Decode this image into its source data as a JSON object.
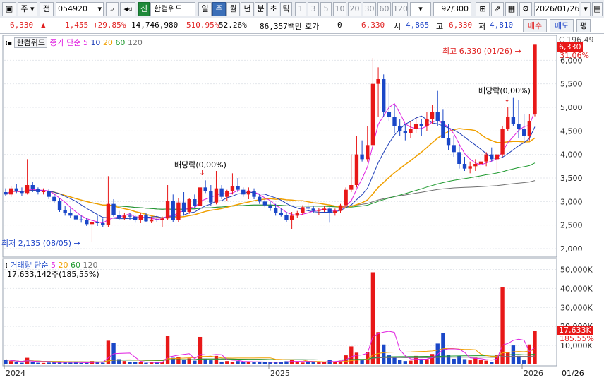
{
  "toolbar": {
    "market": "주",
    "scope": "전",
    "code": "054920",
    "badge": "신",
    "name": "한컴위드",
    "periods": [
      "일",
      "주",
      "월",
      "년",
      "분",
      "초",
      "틱"
    ],
    "minutes": [
      "1",
      "3",
      "5",
      "10",
      "20",
      "30",
      "60",
      "120"
    ],
    "count": "92/300",
    "date": "2026/01/26"
  },
  "info": {
    "price": "6,330",
    "change": "1,455",
    "rate": "+29.85%",
    "volume": "14,746,980",
    "vol_ratio": "510.95%",
    "turnover": "52.26%",
    "amount": "86,357백만",
    "quote_label": "호가",
    "quote_val": "0",
    "quote_price": "6,330",
    "open_label": "시",
    "open": "4,865",
    "high_label": "고",
    "high": "6,330",
    "low_label": "저",
    "low": "4,810",
    "buy": "매수",
    "sell": "매도",
    "eval": "평"
  },
  "price_legend": {
    "name": "한컴위드",
    "prefix": "종가 단순",
    "ma": [
      "5",
      "10",
      "20",
      "60",
      "120"
    ]
  },
  "volume_legend": {
    "prefix": "거래량 단순",
    "ma": [
      "5",
      "20",
      "60",
      "120"
    ],
    "value": "17,633,142주(185,55%)"
  },
  "annotations": {
    "high": "최고 6,330 (01/26)",
    "low": "최저 2,135 (08/05)",
    "div1": "배당락(0,00%)",
    "div2": "배당락(0,00%)"
  },
  "right_axis": {
    "top_label": "C 196.49",
    "price_tag": "6,330",
    "pct_tag": "31.06%",
    "ticks": [
      "6,000",
      "5,500",
      "5,000",
      "4,500",
      "4,000",
      "3,500",
      "3,000",
      "2,500",
      "2,000"
    ],
    "vol_ticks": [
      "50,000K",
      "40,000K",
      "30,000K",
      "20,000K",
      "10,000K"
    ],
    "vol_tag": "17,633K",
    "vol_pct": "185.55%",
    "date_tag": "01/26"
  },
  "x_axis": [
    "2024",
    "2025",
    "2026"
  ],
  "colors": {
    "up": "#e81818",
    "down": "#1a47c8",
    "ma5": "#e020e0",
    "ma10": "#1f3fb8",
    "ma20": "#f0a000",
    "ma60": "#1f9a2f",
    "ma120": "#707070"
  },
  "chart_data": {
    "type": "candlestick",
    "period": "weekly",
    "ylim": [
      1850,
      6500
    ],
    "candles": [
      [
        3200,
        3280,
        3120,
        3150
      ],
      [
        3150,
        3320,
        3100,
        3280
      ],
      [
        3280,
        3380,
        3180,
        3220
      ],
      [
        3220,
        3300,
        3120,
        3180
      ],
      [
        3180,
        3900,
        3150,
        3350
      ],
      [
        3350,
        3420,
        3200,
        3260
      ],
      [
        3260,
        3300,
        3150,
        3200
      ],
      [
        3200,
        3280,
        3150,
        3220
      ],
      [
        3220,
        3260,
        3050,
        3100
      ],
      [
        3100,
        3150,
        2980,
        3020
      ],
      [
        3020,
        3080,
        2780,
        2820
      ],
      [
        2820,
        2900,
        2700,
        2750
      ],
      [
        2750,
        2850,
        2650,
        2700
      ],
      [
        2700,
        2780,
        2580,
        2620
      ],
      [
        2620,
        2700,
        2550,
        2600
      ],
      [
        2600,
        2660,
        2480,
        2520
      ],
      [
        2520,
        2620,
        2135,
        2560
      ],
      [
        2560,
        2700,
        2480,
        2540
      ],
      [
        2540,
        2640,
        2450,
        2500
      ],
      [
        2500,
        3540,
        2450,
        2950
      ],
      [
        2950,
        3050,
        2680,
        2720
      ],
      [
        2720,
        2800,
        2600,
        2650
      ],
      [
        2650,
        2750,
        2600,
        2700
      ],
      [
        2700,
        2760,
        2600,
        2680
      ],
      [
        2680,
        2720,
        2550,
        2600
      ],
      [
        2600,
        2750,
        2540,
        2720
      ],
      [
        2720,
        2760,
        2560,
        2580
      ],
      [
        2580,
        2680,
        2540,
        2620
      ],
      [
        2620,
        2700,
        2560,
        2600
      ],
      [
        2600,
        2680,
        2460,
        2640
      ],
      [
        2640,
        3350,
        2600,
        3020
      ],
      [
        3020,
        3150,
        2560,
        2600
      ],
      [
        2600,
        3080,
        2560,
        2980
      ],
      [
        2980,
        3200,
        2700,
        2780
      ],
      [
        2780,
        3080,
        2740,
        3050
      ],
      [
        3050,
        3150,
        2850,
        2900
      ],
      [
        2900,
        3500,
        2860,
        3300
      ],
      [
        3300,
        3450,
        3180,
        3220
      ],
      [
        3220,
        3350,
        2900,
        2980
      ],
      [
        2980,
        3650,
        2940,
        3280
      ],
      [
        3280,
        3350,
        3050,
        3100
      ],
      [
        3100,
        3250,
        3020,
        3220
      ],
      [
        3220,
        3600,
        3150,
        3320
      ],
      [
        3320,
        3500,
        3200,
        3250
      ],
      [
        3250,
        3300,
        3100,
        3150
      ],
      [
        3150,
        3300,
        3050,
        3220
      ],
      [
        3220,
        3280,
        3050,
        3100
      ],
      [
        3100,
        3150,
        2950,
        3000
      ],
      [
        3000,
        3060,
        2880,
        2920
      ],
      [
        2920,
        3000,
        2800,
        2860
      ],
      [
        2860,
        2950,
        2700,
        2750
      ],
      [
        2750,
        2850,
        2680,
        2720
      ],
      [
        2720,
        2780,
        2560,
        2600
      ],
      [
        2600,
        2780,
        2420,
        2700
      ],
      [
        2700,
        2800,
        2650,
        2760
      ],
      [
        2760,
        2920,
        2720,
        2880
      ],
      [
        2880,
        2960,
        2820,
        2850
      ],
      [
        2850,
        2900,
        2750,
        2800
      ],
      [
        2800,
        2860,
        2720,
        2820
      ],
      [
        2820,
        2900,
        2780,
        2850
      ],
      [
        2850,
        2880,
        2550,
        2750
      ],
      [
        2750,
        2850,
        2700,
        2800
      ],
      [
        2800,
        2950,
        2760,
        2920
      ],
      [
        2920,
        3300,
        2900,
        3250
      ],
      [
        3250,
        4000,
        3200,
        3350
      ],
      [
        3350,
        4400,
        3300,
        4000
      ],
      [
        4000,
        4300,
        3850,
        3900
      ],
      [
        3900,
        4600,
        3850,
        4200
      ],
      [
        4200,
        6050,
        4150,
        5500
      ],
      [
        5500,
        5850,
        4800,
        5600
      ],
      [
        5600,
        5700,
        4800,
        4900
      ],
      [
        4900,
        5500,
        4700,
        4800
      ],
      [
        4800,
        5050,
        4450,
        4600
      ],
      [
        4600,
        4750,
        4400,
        4500
      ],
      [
        4500,
        4650,
        4300,
        4450
      ],
      [
        4450,
        4700,
        4350,
        4550
      ],
      [
        4550,
        4800,
        4450,
        4650
      ],
      [
        4650,
        4750,
        4400,
        4600
      ],
      [
        4600,
        4900,
        4500,
        4750
      ],
      [
        4750,
        5050,
        4650,
        4900
      ],
      [
        4900,
        5350,
        4600,
        4700
      ],
      [
        4700,
        4950,
        4500,
        4350
      ],
      [
        4350,
        4650,
        4100,
        4200
      ],
      [
        4200,
        4400,
        3950,
        4050
      ],
      [
        4050,
        4200,
        3700,
        3800
      ],
      [
        3800,
        3950,
        3650,
        3700
      ],
      [
        3700,
        3850,
        3600,
        3750
      ],
      [
        3750,
        3900,
        3650,
        3800
      ],
      [
        3800,
        3950,
        3700,
        3850
      ],
      [
        3850,
        4050,
        3750,
        4000
      ],
      [
        4000,
        4150,
        3850,
        3900
      ],
      [
        3900,
        4000,
        3650,
        4000
      ],
      [
        4000,
        4600,
        3950,
        4550
      ],
      [
        4550,
        5000,
        4500,
        4800
      ],
      [
        4800,
        5200,
        4600,
        4650
      ],
      [
        4650,
        5150,
        4350,
        4550
      ],
      [
        4550,
        4850,
        4300,
        4400
      ],
      [
        4400,
        4850,
        4300,
        4700
      ],
      [
        4865,
        6330,
        4810,
        6330
      ]
    ],
    "volume_ylim": [
      0,
      55000
    ],
    "volume": [
      2500,
      1800,
      1200,
      900,
      3500,
      1400,
      900,
      800,
      1000,
      1200,
      1400,
      1100,
      900,
      1000,
      800,
      900,
      1800,
      1300,
      900,
      12500,
      11500,
      2800,
      1800,
      1400,
      1200,
      1100,
      900,
      1000,
      1000,
      1200,
      15000,
      3500,
      4000,
      2600,
      3200,
      2000,
      14500,
      3000,
      2200,
      4500,
      1500,
      1800,
      1400,
      1800,
      1500,
      1200,
      1100,
      1300,
      1400,
      1100,
      1200,
      1300,
      1700,
      2500,
      1400,
      1000,
      1400,
      1100,
      1300,
      1500,
      2400,
      1600,
      2000,
      4800,
      9500,
      6200,
      2500,
      6500,
      48500,
      17000,
      10500,
      4800,
      3500,
      2500,
      1800,
      2000,
      4500,
      3000,
      2800,
      5500,
      11000,
      16500,
      5000,
      3000,
      4500,
      2800,
      2200,
      3500,
      2400,
      2000,
      1400,
      4800,
      40500,
      6500,
      10000,
      4500,
      2200,
      10500,
      17633
    ]
  }
}
